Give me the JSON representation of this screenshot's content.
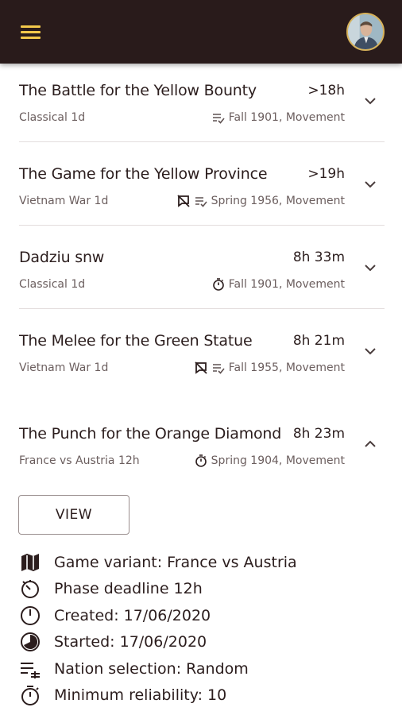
{
  "app_bar": {
    "menu_icon": "hamburger-menu-icon",
    "avatar_icon": "user-avatar",
    "accent_color": "#f2c84b",
    "bar_color": "#291b1b"
  },
  "games": [
    {
      "title": "The Battle for the Yellow Bounty",
      "time": ">18h",
      "variant": "Classical 1d",
      "phase": "Fall 1901, Movement",
      "icons": [
        "nation-assignment-icon"
      ],
      "expanded": false
    },
    {
      "title": "The Game for the Yellow Province",
      "time": ">19h",
      "variant": "Vietnam War 1d",
      "phase": "Spring 1956, Movement",
      "icons": [
        "no-chat-icon",
        "nation-assignment-icon"
      ],
      "expanded": false
    },
    {
      "title": "Dadziu snw",
      "time": "8h 33m",
      "variant": "Classical 1d",
      "phase": "Fall 1901, Movement",
      "icons": [
        "stopwatch-icon"
      ],
      "expanded": false
    },
    {
      "title": "The Melee for the Green Statue",
      "time": "8h 21m",
      "variant": "Vietnam War 1d",
      "phase": "Fall 1955, Movement",
      "icons": [
        "no-chat-icon",
        "nation-assignment-icon"
      ],
      "expanded": false
    },
    {
      "title": "The Punch for the Orange Diamond",
      "time": "8h 23m",
      "variant": "France vs Austria 12h",
      "phase": "Spring 1904, Movement",
      "icons": [
        "stopwatch-icon"
      ],
      "expanded": true
    }
  ],
  "expanded_details": {
    "view_label": "VIEW",
    "items": [
      {
        "icon": "map-icon",
        "text": "Game variant: France vs Austria"
      },
      {
        "icon": "timer-icon",
        "text": "Phase deadline 12h"
      },
      {
        "icon": "clock-icon",
        "text": "Created: 17/06/2020"
      },
      {
        "icon": "progress-clock-icon",
        "text": "Started: 17/06/2020"
      },
      {
        "icon": "nation-selection-icon",
        "text": "Nation selection: Random"
      },
      {
        "icon": "stopwatch-icon",
        "text": "Minimum reliability: 10"
      }
    ]
  }
}
